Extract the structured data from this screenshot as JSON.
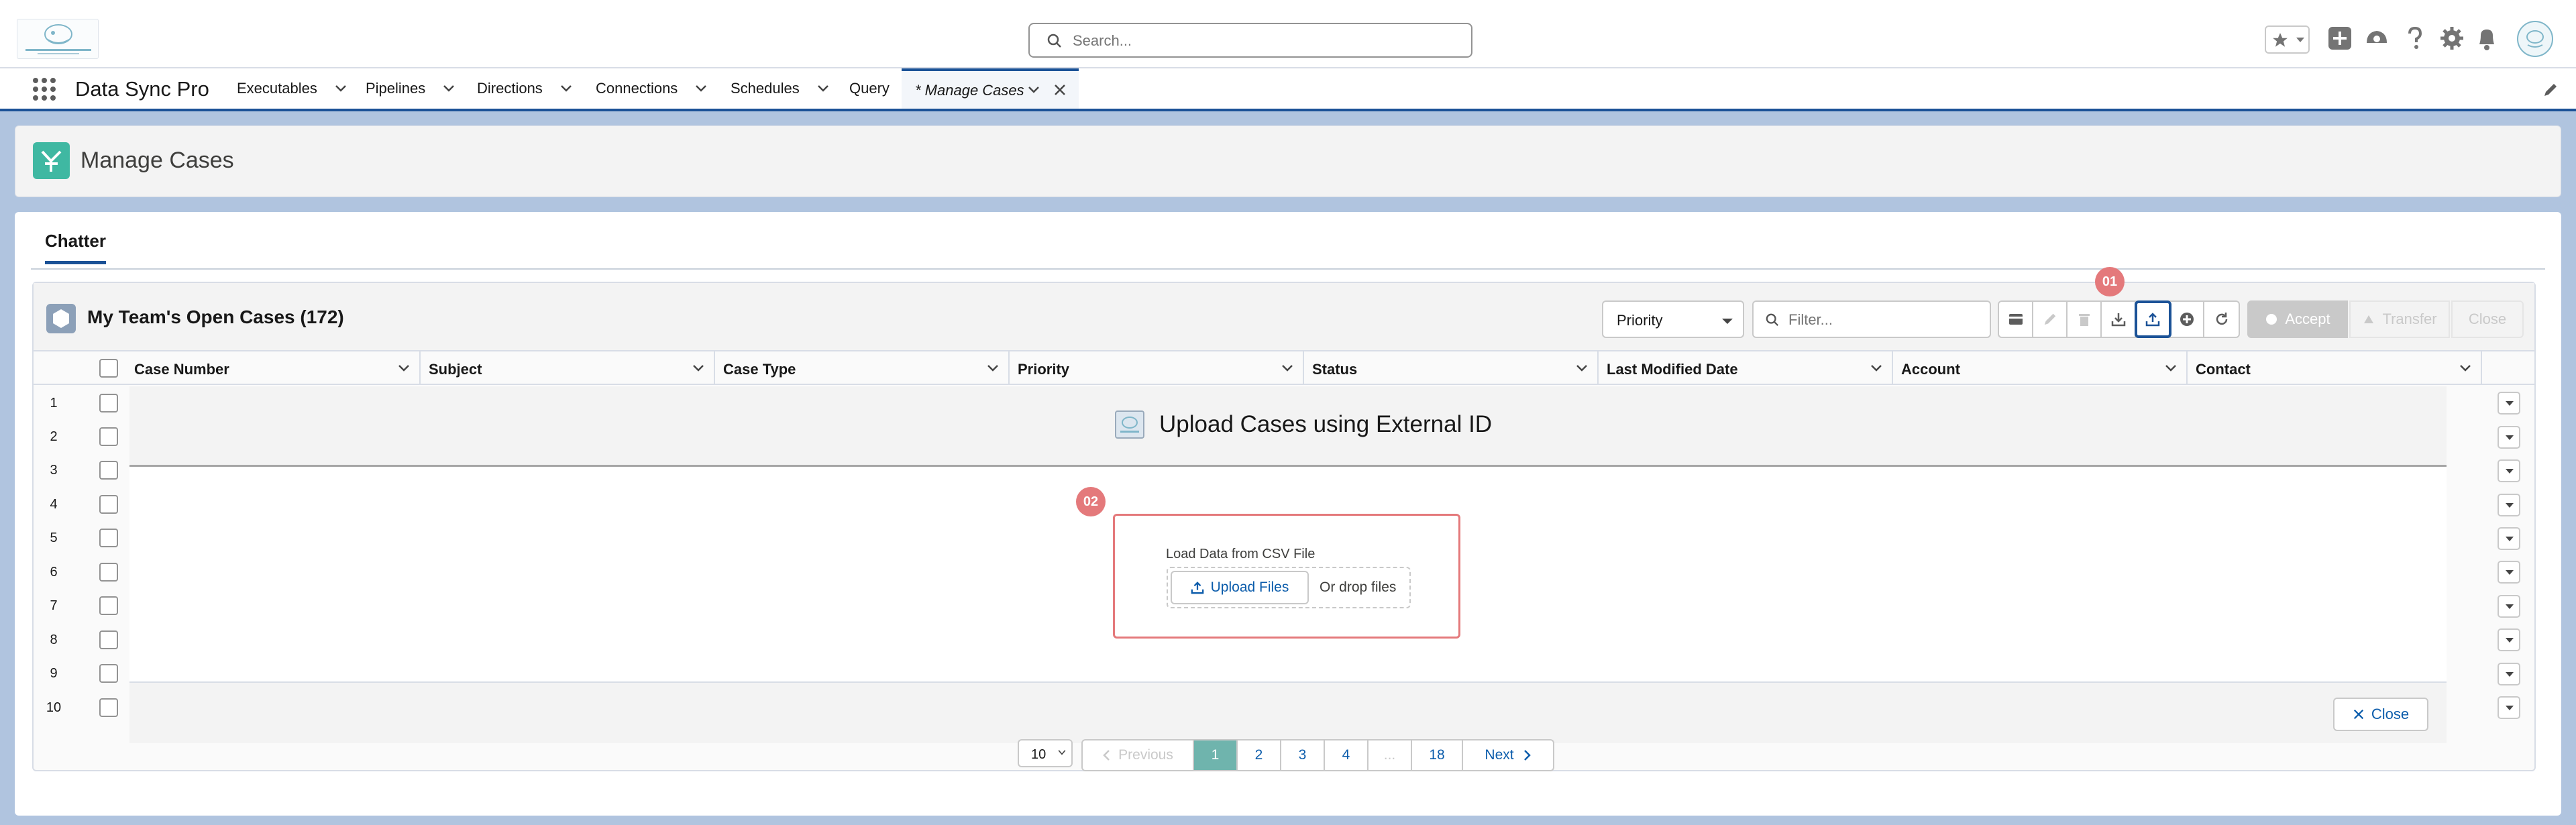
{
  "header": {
    "search_placeholder": "Search..."
  },
  "nav": {
    "app_name": "Data Sync Pro",
    "items": [
      {
        "label": "Executables"
      },
      {
        "label": "Pipelines"
      },
      {
        "label": "Directions"
      },
      {
        "label": "Connections"
      },
      {
        "label": "Schedules"
      },
      {
        "label": "Query"
      }
    ],
    "active_tab": "* Manage Cases"
  },
  "page": {
    "title": "Manage Cases",
    "tabs": [
      {
        "label": "Chatter"
      }
    ]
  },
  "list": {
    "title": "My Team's Open Cases (172)",
    "priority_filter": "Priority",
    "filter_placeholder": "Filter...",
    "actions": {
      "accept": "Accept",
      "transfer": "Transfer",
      "close": "Close"
    },
    "columns": [
      "Case Number",
      "Subject",
      "Case Type",
      "Priority",
      "Status",
      "Last Modified Date",
      "Account",
      "Contact"
    ],
    "row_numbers": [
      "1",
      "2",
      "3",
      "4",
      "5",
      "6",
      "7",
      "8",
      "9",
      "10"
    ]
  },
  "modal": {
    "title": "Upload Cases using External ID",
    "upload_label": "Load Data from CSV File",
    "upload_button": "Upload Files",
    "drop_text": "Or drop files",
    "close_label": "Close"
  },
  "annotations": {
    "marker_1": "01",
    "marker_2": "02"
  },
  "pagination": {
    "page_size": "10",
    "previous": "Previous",
    "pages": [
      "1",
      "2",
      "3",
      "4",
      "...",
      "18"
    ],
    "current_page": "1",
    "next": "Next"
  },
  "colors": {
    "brand": "#1b5297",
    "marker": "#e4797b",
    "page_icon": "#3fb8a2"
  }
}
